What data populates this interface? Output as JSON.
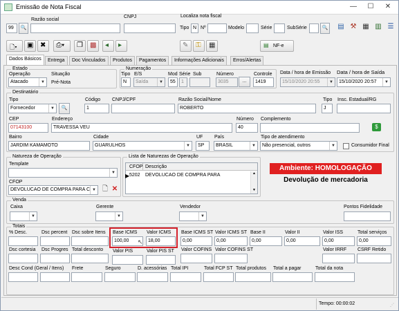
{
  "window": {
    "title": "Emissão de Nota Fiscal",
    "min": "—",
    "max": "☐",
    "close": "✕"
  },
  "header": {
    "razao_social_label": "Razão social",
    "cnpj_label": "CNPJ",
    "localiza_label": "Localiza nota fiscal",
    "codigo_value": "99",
    "tipo_label": "Tipo",
    "n_label": "N",
    "no_label": "Nº",
    "modelo_label": "Modelo",
    "serie_label": "Série",
    "subserie_label": "SubSérie"
  },
  "toolbar": {
    "nfe_label": "NF-e"
  },
  "tabs": [
    {
      "label": "Dados Básicos"
    },
    {
      "label": "Entrega"
    },
    {
      "label": "Doc Vinculados"
    },
    {
      "label": "Produtos"
    },
    {
      "label": "Pagamentos"
    },
    {
      "label": "Informações Adicionais"
    },
    {
      "label": "Erros/Alertas"
    }
  ],
  "estado": {
    "group_label": "Estado",
    "operacao_label": "Operação",
    "operacao_value": "Atacado",
    "situacao_label": "Situação",
    "situacao_value": "Pré-Nota"
  },
  "numeracao": {
    "group_label": "Numeração",
    "tipo_label": "Tipo",
    "tipo_value": "N",
    "es_label": "E/S",
    "es_value": "Saída",
    "mod_label": "Mod",
    "mod_value": "55",
    "serie_label": "Série",
    "serie_value": "1",
    "sub_label": "Sub",
    "numero_label": "Número",
    "numero_value": "3035",
    "controle_label": "Controle",
    "controle_value": "1419",
    "data_emissao_label": "Data / hora de Emissão",
    "data_emissao_value": "15/10/2020 20:55",
    "data_saida_label": "Data / hora de Saída",
    "data_saida_value": "15/10/2020 20:57"
  },
  "destinatario": {
    "group_label": "Destinatário",
    "tipo_label": "Tipo",
    "tipo_value": "Fornecedor",
    "codigo_label": "Código",
    "codigo_value": "1",
    "cnpj_label": "CNPJ/CPF",
    "razao_label": "Razão Social/Nome",
    "razao_value": "ROBERTO",
    "tipo2_label": "Tipo",
    "tipo2_value": "J",
    "ie_label": "Insc. Estadual/RG",
    "cep_label": "CEP",
    "cep_value": "07143100",
    "endereco_label": "Endereço",
    "endereco_value": "TRAVESSA VEU",
    "numero_label": "Número",
    "numero_value": "40",
    "complemento_label": "Complemento",
    "bairro_label": "Bairro",
    "bairro_value": "JARDIM KAMAMOTO",
    "cidade_label": "Cidade",
    "cidade_value": "GUARULHOS",
    "uf_label": "UF",
    "uf_value": "SP",
    "pais_label": "País",
    "pais_value": "BRASIL",
    "atendimento_label": "Tipo de atendimento",
    "atendimento_value": "Não presencial, outros",
    "consumidor_label": "Consumidor Final"
  },
  "natureza": {
    "group_label": "Natureza de Operação",
    "template_label": "Template",
    "cfop_label": "CFOP",
    "cfop_value": "DEVOLUCAO DE COMPRA PARA C",
    "lista_label": "Lista de Naturezas de Operação",
    "col_cfop": "CFOP",
    "col_desc": "Descrição",
    "row_cfop": "5202",
    "row_desc": "DEVOLUCAO DE COMPRA PARA"
  },
  "ambiente": {
    "label": "Ambiente: HOMOLOGAÇÃO",
    "tipo": "Devolução de mercadoria"
  },
  "venda": {
    "group_label": "Venda",
    "caixa_label": "Caixa",
    "gerente_label": "Gerente",
    "vendedor_label": "Vendedor",
    "pontos_label": "Pontos Fidelidade"
  },
  "totais": {
    "group_label": "Totais",
    "pct_desc": "% Desc.",
    "dsc_percent": "Dsc percent",
    "dsc_sobre": "Dsc sobre Itens",
    "base_icms": "Base ICMS",
    "base_icms_value": "100,00",
    "valor_icms": "Valor ICMS",
    "valor_icms_value": "18,00",
    "base_icms_st": "Base ICMS ST",
    "base_icms_st_value": "0,00",
    "valor_icms_st": "Valor ICMS ST",
    "valor_icms_st_value": "0,00",
    "base_ii": "Base II",
    "base_ii_value": "0,00",
    "valor_ii": "Valor II",
    "valor_ii_value": "0,00",
    "valor_iss": "Valor ISS",
    "valor_iss_value": "0,00",
    "total_servicos": "Total serviços",
    "total_servicos_value": "0,00",
    "dsc_cortesia": "Dsc cortesia",
    "dsc_progres": "Dsc Progres",
    "total_desconto": "Total desconto",
    "valor_pis": "Valor PIS",
    "valor_pis_st": "Valor PIS ST",
    "valor_cofins": "Valor COFINS",
    "valor_cofins_st": "Valor COFINS ST",
    "valor_irrf": "Valor IRRF",
    "csrf_retido": "CSRF Retido",
    "desc_cond": "Desc Cond (Geral / Itens)",
    "frete": "Frete",
    "seguro": "Seguro",
    "d_acessorias": "D. acessórias",
    "total_ipi": "Total IPI",
    "total_fcp_st": "Total FCP ST",
    "total_produtos": "Total produtos",
    "total_pagar": "Total a pagar",
    "total_nota": "Total da nota"
  },
  "status": {
    "tempo": "Tempo: 00:00:02"
  }
}
